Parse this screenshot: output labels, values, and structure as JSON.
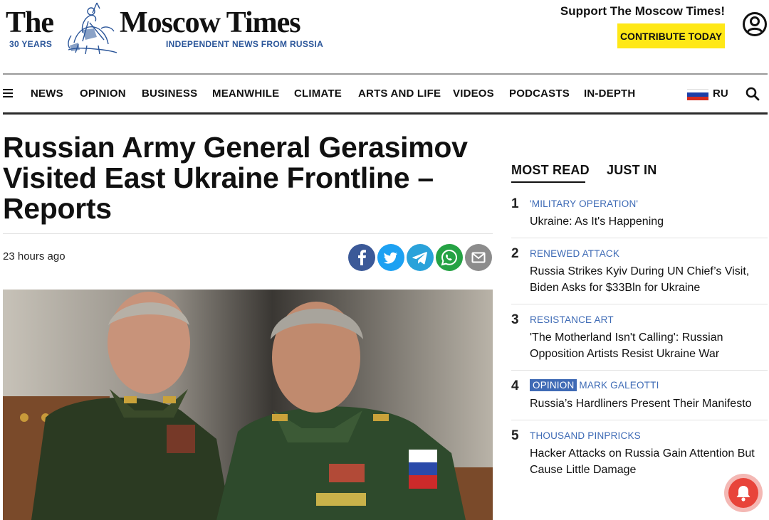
{
  "header": {
    "logo_the": "The",
    "logo_name": "Moscow Times",
    "logo_years": "30 YEARS",
    "logo_tagline": "INDEPENDENT NEWS FROM RUSSIA",
    "support_text": "Support The Moscow Times!",
    "contribute_label": "CONTRIBUTE TODAY",
    "account_icon": "user-circle-icon"
  },
  "nav": {
    "menu_icon": "hamburger-icon",
    "items": [
      "NEWS",
      "OPINION",
      "BUSINESS",
      "MEANWHILE",
      "CLIMATE",
      "ARTS AND LIFE",
      "VIDEOS",
      "PODCASTS",
      "IN-DEPTH"
    ],
    "language": "RU",
    "flag_colors": [
      "#ffffff",
      "#1c3fa8",
      "#d52b1e"
    ],
    "search_icon": "search-icon"
  },
  "article": {
    "headline": "Russian Army General Gerasimov Visited East Ukraine Frontline – Reports",
    "timestamp": "23 hours ago",
    "share": [
      {
        "name": "facebook-icon",
        "color": "#3b5998"
      },
      {
        "name": "twitter-icon",
        "color": "#1da1f2"
      },
      {
        "name": "telegram-icon",
        "color": "#2aa2da"
      },
      {
        "name": "whatsapp-icon",
        "color": "#25a244"
      },
      {
        "name": "email-icon",
        "color": "#8c8c8c"
      }
    ]
  },
  "sidebar": {
    "tabs": [
      "MOST READ",
      "JUST IN"
    ],
    "active_tab": "MOST READ",
    "items": [
      {
        "num": "1",
        "category": "'MILITARY OPERATION'",
        "title": "Ukraine: As It's Happening"
      },
      {
        "num": "2",
        "category": "RENEWED ATTACK",
        "title": "Russia Strikes Kyiv During UN Chief’s Visit, Biden Asks for $33Bln for Ukraine"
      },
      {
        "num": "3",
        "category": "RESISTANCE ART",
        "title": "'The Motherland Isn't Calling': Russian Opposition Artists Resist Ukraine War"
      },
      {
        "num": "4",
        "badge": "OPINION",
        "category": "MARK GALEOTTI",
        "title": "Russia’s Hardliners Present Their Manifesto"
      },
      {
        "num": "5",
        "category": "THOUSAND PINPRICKS",
        "title": "Hacker Attacks on Russia Gain Attention But Cause Little Damage"
      }
    ],
    "notification_icon": "bell-icon"
  },
  "colors": {
    "accent_blue": "#3d6ab5",
    "contribute_yellow": "#ffe817",
    "notification_red": "#e8443a"
  }
}
